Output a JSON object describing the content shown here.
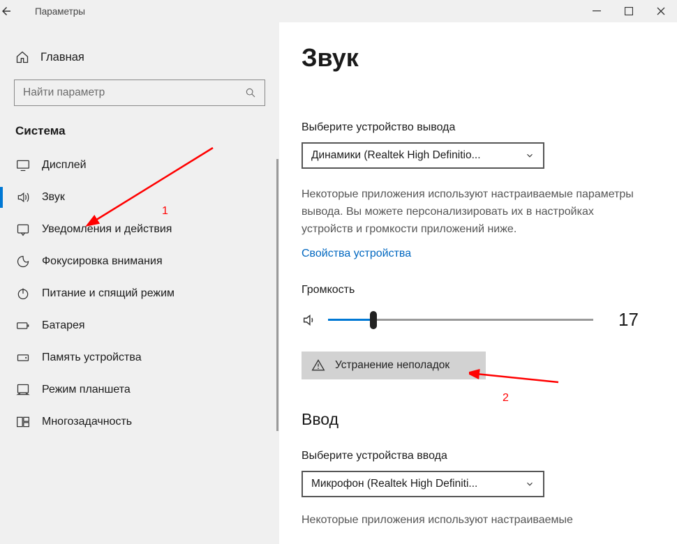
{
  "titlebar": {
    "title": "Параметры"
  },
  "sidebar": {
    "home": "Главная",
    "search_placeholder": "Найти параметр",
    "group": "Система",
    "items": [
      {
        "label": "Дисплей"
      },
      {
        "label": "Звук"
      },
      {
        "label": "Уведомления и действия"
      },
      {
        "label": "Фокусировка внимания"
      },
      {
        "label": "Питание и спящий режим"
      },
      {
        "label": "Батарея"
      },
      {
        "label": "Память устройства"
      },
      {
        "label": "Режим планшета"
      },
      {
        "label": "Многозадачность"
      }
    ]
  },
  "page": {
    "title": "Звук",
    "output_label": "Выберите устройство вывода",
    "output_device": "Динамики (Realtek High Definitio...",
    "output_desc": "Некоторые приложения используют настраиваемые параметры вывода. Вы можете персонализировать их в настройках устройств и громкости приложений ниже.",
    "device_props": "Свойства устройства",
    "volume_label": "Громкость",
    "volume_value": "17",
    "troubleshoot": "Устранение неполадок",
    "input_heading": "Ввод",
    "input_label": "Выберите устройства ввода",
    "input_device": "Микрофон (Realtek High Definiti...",
    "input_desc": "Некоторые приложения используют настраиваемые"
  },
  "annotations": {
    "a1": "1",
    "a2": "2"
  }
}
